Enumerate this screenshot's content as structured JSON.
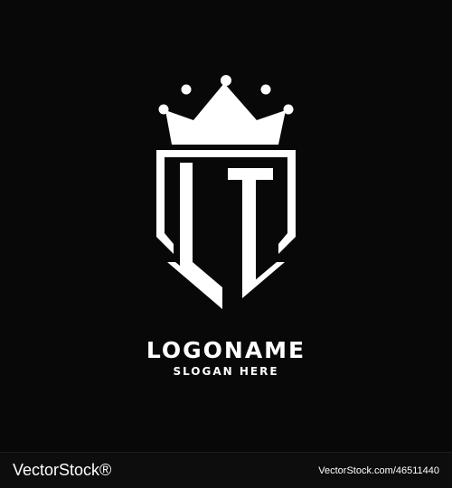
{
  "logo": {
    "monogram": "LT",
    "brand_name": "LOGONAME",
    "slogan": "SLOGAN HERE",
    "icon": "crown-shield-icon",
    "foreground_color": "#ffffff",
    "background_color": "#080808"
  },
  "footer": {
    "brand": "VectorStock®",
    "image_id": "VectorStock.com/46511440"
  }
}
